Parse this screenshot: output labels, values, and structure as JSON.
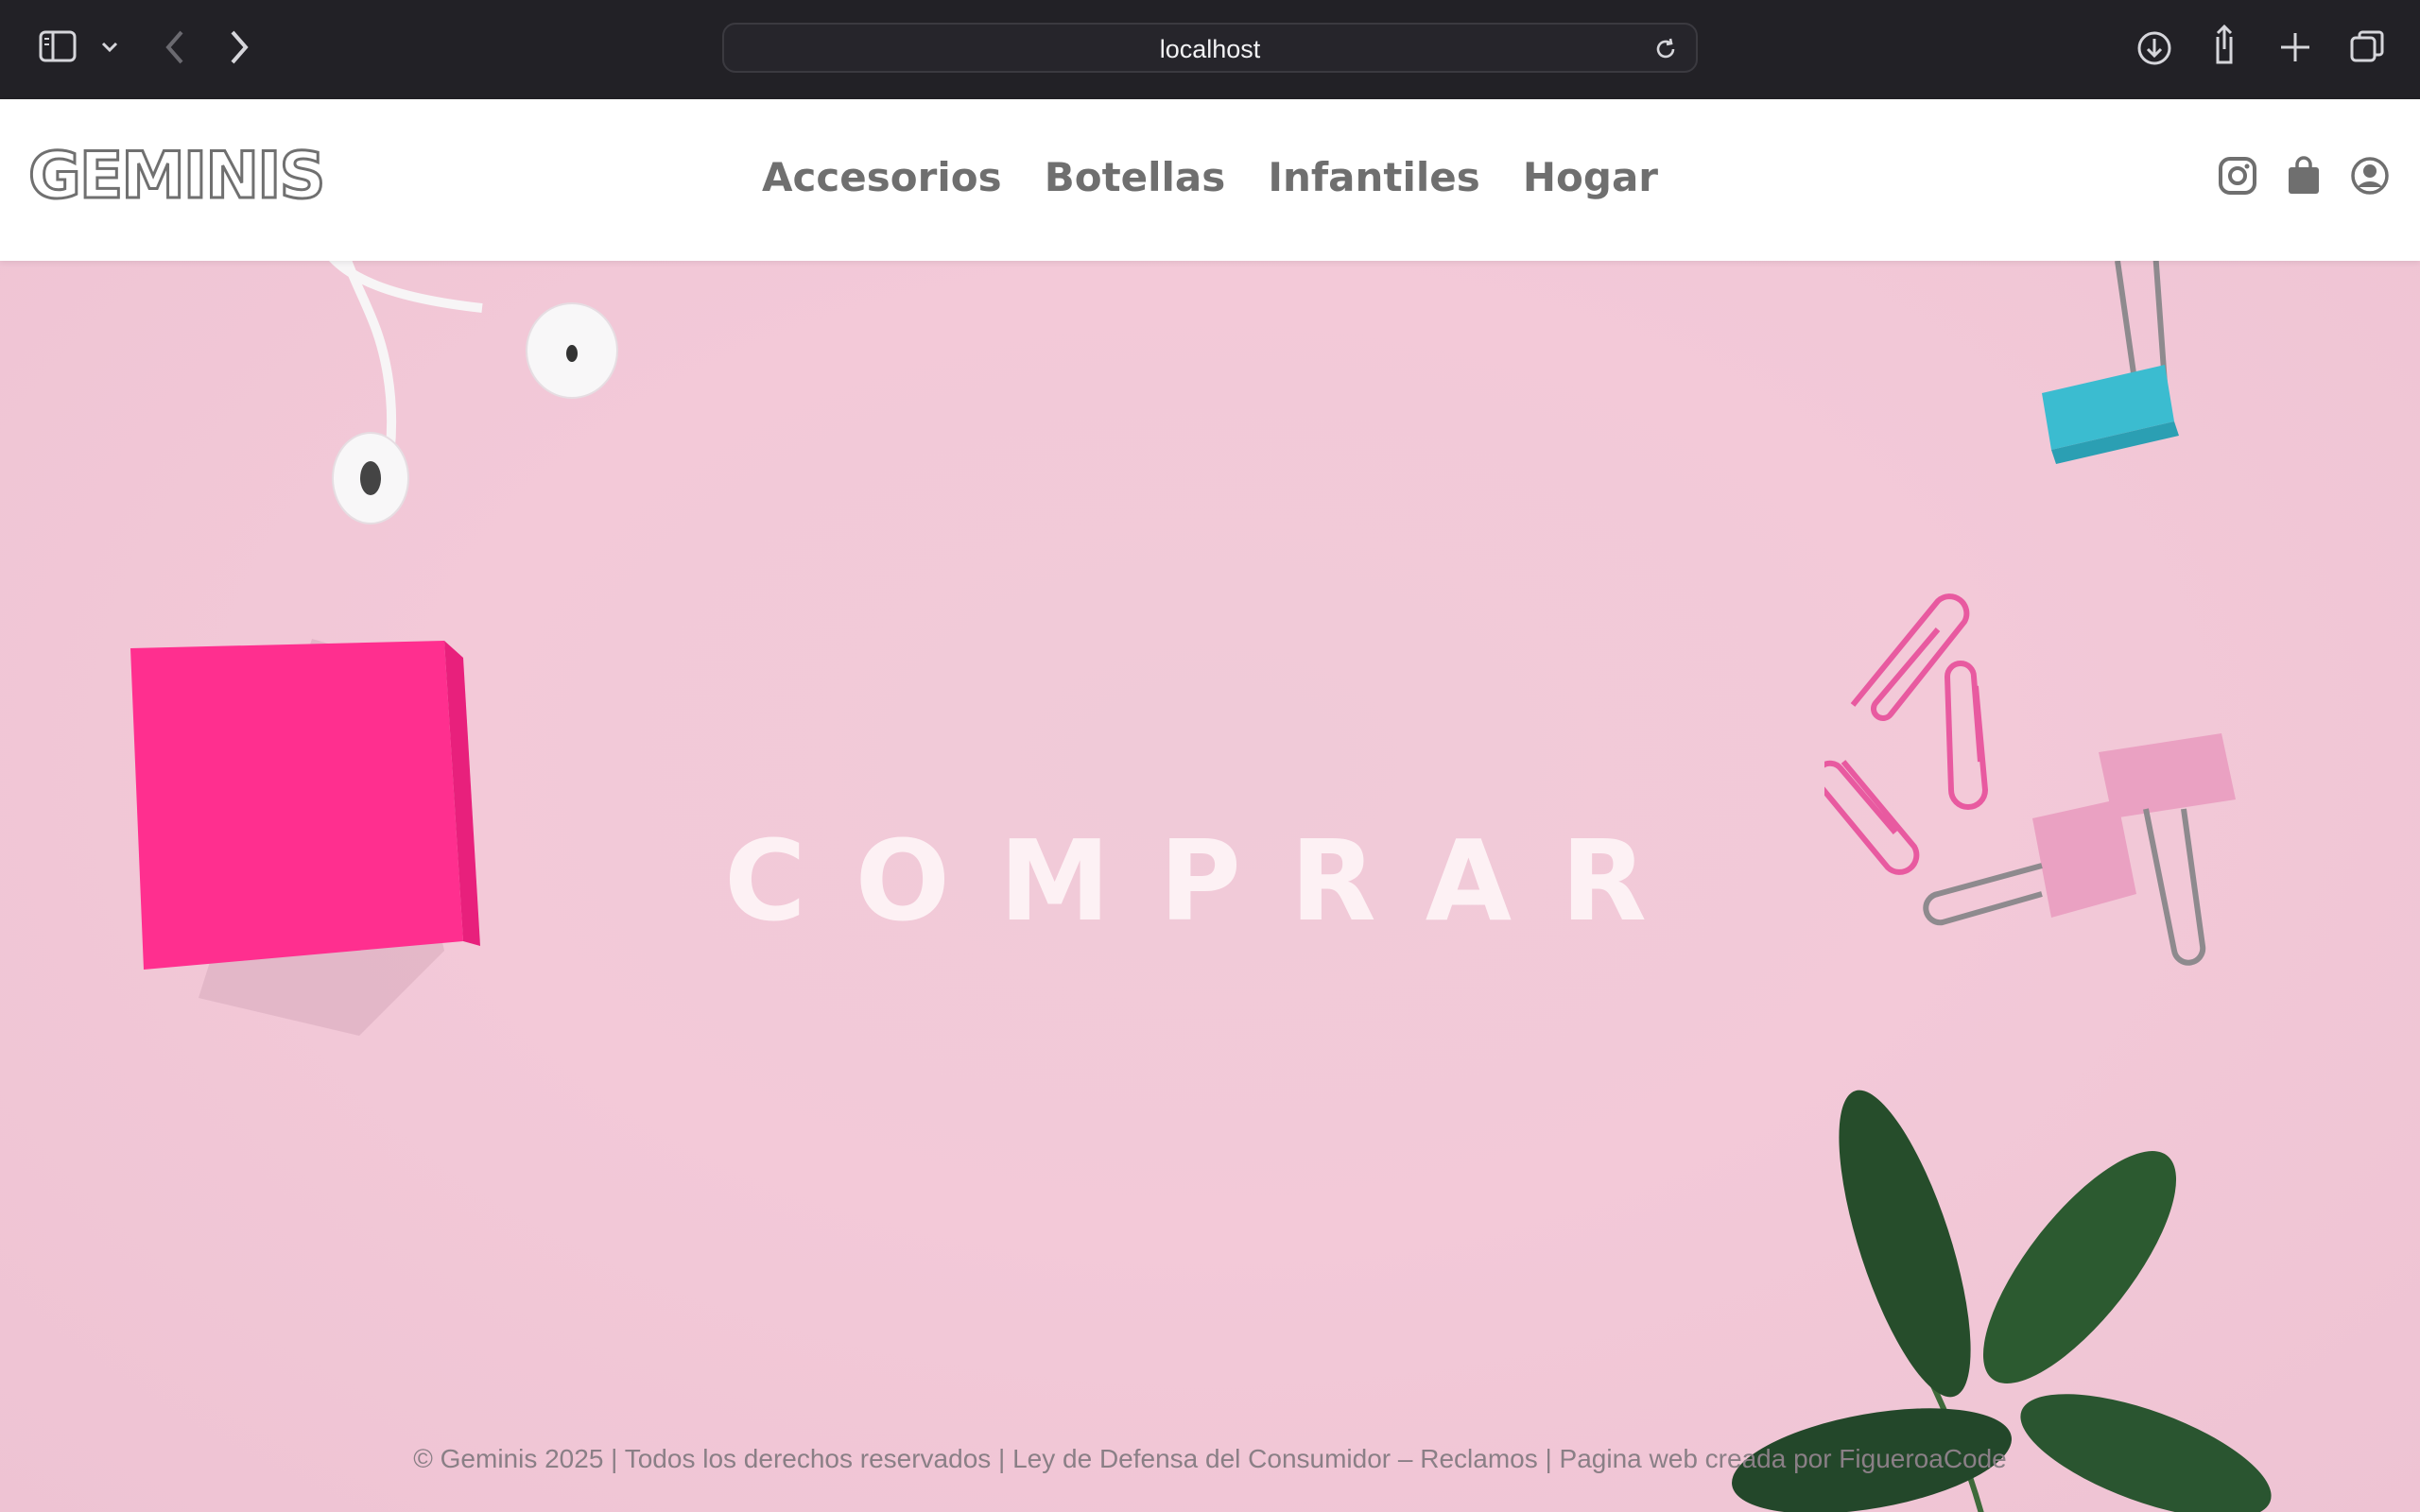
{
  "browser": {
    "url": "localhost",
    "icons": [
      "sidebar-icon",
      "chevron-down-icon",
      "back-icon",
      "forward-icon",
      "reload-icon",
      "download-icon",
      "share-icon",
      "plus-icon",
      "tabs-icon"
    ]
  },
  "header": {
    "logo": "GEMINIS",
    "nav": [
      "Accesorios",
      "Botellas",
      "Infantiles",
      "Hogar"
    ],
    "icons": [
      "instagram-icon",
      "shopping-bag-icon",
      "user-icon"
    ]
  },
  "hero": {
    "title": "COMPRAR"
  },
  "footer": {
    "text": "© Geminis 2025 | Todos los derechos reservados | Ley de Defensa del Consumidor – Reclamos | Pagina web creada por FigueroaCode"
  },
  "colors": {
    "chrome_bg": "#222126",
    "hero_bg": "#f1c8d6",
    "nav_text": "#6f6f6f",
    "sticky_note": "#ff2f8f",
    "clip_blue": "#3bbcd0",
    "leaf": "#264d2b"
  }
}
